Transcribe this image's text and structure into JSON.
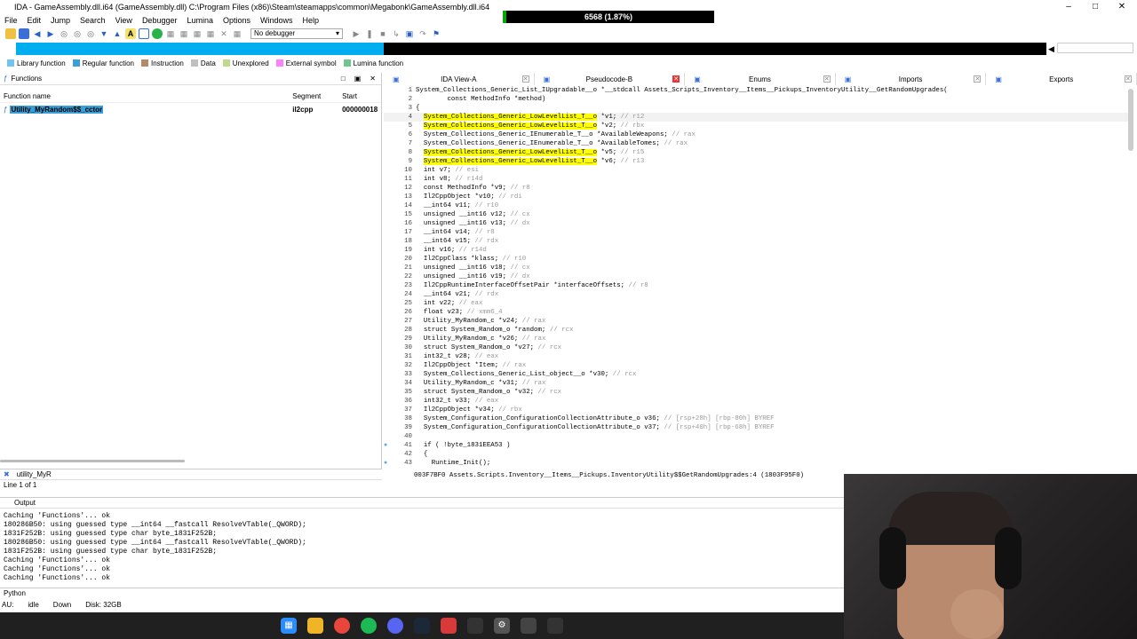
{
  "window": {
    "title": "IDA - GameAssembly.dll.i64 (GameAssembly.dll) C:\\Program Files (x86)\\Steam\\steamapps\\common\\Megabonk\\GameAssembly.dll.i64",
    "progress_text": "6568 (1.87%)",
    "progress_fraction": 0.0187
  },
  "menu": [
    "File",
    "Edit",
    "Jump",
    "Search",
    "View",
    "Debugger",
    "Lumina",
    "Options",
    "Windows",
    "Help"
  ],
  "toolbar": {
    "debugger_select": "No debugger"
  },
  "legend": [
    {
      "label": "Library function",
      "color": "#6fc5ee"
    },
    {
      "label": "Regular function",
      "color": "#3a9fd8"
    },
    {
      "label": "Instruction",
      "color": "#b38a6a"
    },
    {
      "label": "Data",
      "color": "#c0c0c0"
    },
    {
      "label": "Unexplored",
      "color": "#c2d88a"
    },
    {
      "label": "External symbol",
      "color": "#ff80ff"
    },
    {
      "label": "Lumina function",
      "color": "#6fc58f"
    }
  ],
  "functions": {
    "title": "Functions",
    "col_name": "Function name",
    "col_segment": "Segment",
    "col_start": "Start",
    "row_name": "Utility_MyRandom$$_cctor",
    "row_segment": "il2cpp",
    "row_start": "000000018",
    "search": "utility_MyR",
    "line_status": "Line 1 of 1"
  },
  "tabs": [
    {
      "label": "IDA View-A"
    },
    {
      "label": "Pseudocode-B"
    },
    {
      "label": "Enums"
    },
    {
      "label": "Imports"
    },
    {
      "label": "Exports"
    }
  ],
  "code": [
    {
      "n": "1",
      "t": "System_Collections_Generic_List_IUpgradable__o *__stdcall Assets_Scripts_Inventory__Items__Pickups_InventoryUtility__GetRandomUpgrades(",
      "c": ""
    },
    {
      "n": "2",
      "t": "        const MethodInfo *method)",
      "c": ""
    },
    {
      "n": "3",
      "t": "{",
      "c": ""
    },
    {
      "n": "4",
      "h": "System_Collections_Generic_LowLevelList_T__o",
      "t": " *v1; ",
      "c": "// r12"
    },
    {
      "n": "5",
      "h": "System_Collections_Generic_LowLevelList_T__o",
      "t": " *v2; ",
      "c": "// rbx"
    },
    {
      "n": "6",
      "t": "System_Collections_Generic_IEnumerable_T__o *AvailableWeapons; ",
      "c": "// rax"
    },
    {
      "n": "7",
      "t": "System_Collections_Generic_IEnumerable_T__o *AvailableTomes; ",
      "c": "// rax"
    },
    {
      "n": "8",
      "h": "System_Collections_Generic_LowLevelList_T__o",
      "t": " *v5; ",
      "c": "// r15"
    },
    {
      "n": "9",
      "h": "System_Collections_Generic_LowLevelList_T__o",
      "t": " *v6; ",
      "c": "// r13"
    },
    {
      "n": "10",
      "t": "int v7; ",
      "c": "// esi"
    },
    {
      "n": "11",
      "t": "int v8; ",
      "c": "// r14d"
    },
    {
      "n": "12",
      "t": "const MethodInfo *v9; ",
      "c": "// r8"
    },
    {
      "n": "13",
      "t": "Il2CppObject *v10; ",
      "c": "// rdi"
    },
    {
      "n": "14",
      "t": "__int64 v11; ",
      "c": "// r10"
    },
    {
      "n": "15",
      "t": "unsigned __int16 v12; ",
      "c": "// cx"
    },
    {
      "n": "16",
      "t": "unsigned __int16 v13; ",
      "c": "// dx"
    },
    {
      "n": "17",
      "t": "__int64 v14; ",
      "c": "// r8"
    },
    {
      "n": "18",
      "t": "__int64 v15; ",
      "c": "// rdx"
    },
    {
      "n": "19",
      "t": "int v16; ",
      "c": "// r14d"
    },
    {
      "n": "20",
      "t": "Il2CppClass *klass; ",
      "c": "// r10"
    },
    {
      "n": "21",
      "t": "unsigned __int16 v18; ",
      "c": "// cx"
    },
    {
      "n": "22",
      "t": "unsigned __int16 v19; ",
      "c": "// dx"
    },
    {
      "n": "23",
      "t": "Il2CppRuntimeInterfaceOffsetPair *interfaceOffsets; ",
      "c": "// r8"
    },
    {
      "n": "24",
      "t": "__int64 v21; ",
      "c": "// rdx"
    },
    {
      "n": "25",
      "t": "int v22; ",
      "c": "// eax"
    },
    {
      "n": "26",
      "t": "float v23; ",
      "c": "// xmm6_4"
    },
    {
      "n": "27",
      "t": "Utility_MyRandom_c *v24; ",
      "c": "// rax"
    },
    {
      "n": "28",
      "t": "struct System_Random_o *random; ",
      "c": "// rcx"
    },
    {
      "n": "29",
      "t": "Utility_MyRandom_c *v26; ",
      "c": "// rax"
    },
    {
      "n": "30",
      "t": "struct System_Random_o *v27; ",
      "c": "// rcx"
    },
    {
      "n": "31",
      "t": "int32_t v28; ",
      "c": "// eax"
    },
    {
      "n": "32",
      "t": "Il2CppObject *Item; ",
      "c": "// rax"
    },
    {
      "n": "33",
      "t": "System_Collections_Generic_List_object__o *v30; ",
      "c": "// rcx"
    },
    {
      "n": "34",
      "t": "Utility_MyRandom_c *v31; ",
      "c": "// rax"
    },
    {
      "n": "35",
      "t": "struct System_Random_o *v32; ",
      "c": "// rcx"
    },
    {
      "n": "36",
      "t": "int32_t v33; ",
      "c": "// eax"
    },
    {
      "n": "37",
      "t": "Il2CppObject *v34; ",
      "c": "// rbx"
    },
    {
      "n": "38",
      "t": "System_Configuration_ConfigurationCollectionAttribute_o v36; ",
      "c": "// [rsp+28h] [rbp-80h] BYREF"
    },
    {
      "n": "39",
      "t": "System_Configuration_ConfigurationCollectionAttribute_o v37; ",
      "c": "// [rsp+40h] [rbp-68h] BYREF"
    },
    {
      "n": "40",
      "t": "",
      "c": ""
    },
    {
      "n": "41",
      "t": "if ( !byte_1831EEA53 )",
      "c": "",
      "dot": true
    },
    {
      "n": "42",
      "t": "{",
      "c": ""
    },
    {
      "n": "43",
      "t": "  Runtime_Init();",
      "c": "",
      "dot": true
    }
  ],
  "code_status": "003F7BF0 Assets.Scripts.Inventory__Items__Pickups.InventoryUtility$$GetRandomUpgrades:4 (1803F95F0)",
  "output": {
    "title": "Output",
    "lines": [
      "Caching 'Functions'... ok",
      "180286B50: using guessed type __int64 __fastcall ResolveVTable(_QWORD);",
      "1831F252B: using guessed type char byte_1831F252B;",
      "180286B50: using guessed type __int64 __fastcall ResolveVTable(_QWORD);",
      "1831F252B: using guessed type char byte_1831F252B;",
      "Caching 'Functions'... ok",
      "Caching 'Functions'... ok",
      "Caching 'Functions'... ok"
    ],
    "lang": "Python"
  },
  "status": {
    "au": "AU:",
    "idle": "idle",
    "down": "Down",
    "disk": "Disk: 32GB"
  }
}
